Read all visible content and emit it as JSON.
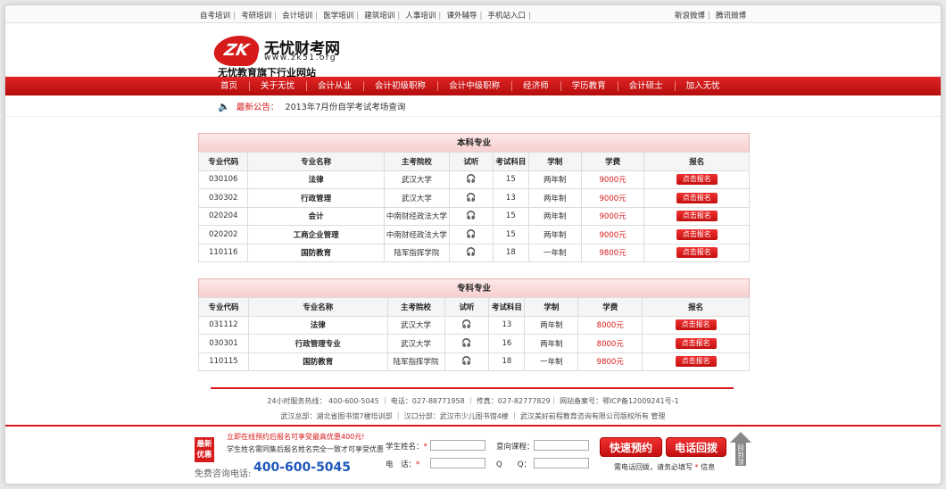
{
  "toplinks": {
    "left": [
      "自考培训",
      "考研培训",
      "会计培训",
      "医学培训",
      "建筑培训",
      "人事培训",
      "课外辅导",
      "手机站入口"
    ],
    "right": [
      "新浪微博",
      "腾讯微博"
    ]
  },
  "logo": {
    "mark": "ZK",
    "name": "无忧财考网",
    "url": "www.zk51.org",
    "tagline": "无忧教育旗下行业网站"
  },
  "nav": [
    "首页",
    "关于无忧",
    "会计从业",
    "会计初级职称",
    "会计中级职称",
    "经济师",
    "学历教育",
    "会计硕士",
    "加入无忧"
  ],
  "notice": {
    "label": "最新公告：",
    "text": "2013年7月份自学考试考场查询"
  },
  "columns": [
    "专业代码",
    "专业名称",
    "主考院校",
    "试听",
    "考试科目",
    "学制",
    "学费",
    "报名"
  ],
  "tables": [
    {
      "title": "本科专业",
      "rows": [
        {
          "code": "030106",
          "name": "法律",
          "school": "武汉大学",
          "subjects": "15",
          "duration": "两年制",
          "fee": "9000元",
          "action": "点击报名"
        },
        {
          "code": "030302",
          "name": "行政管理",
          "school": "武汉大学",
          "subjects": "13",
          "duration": "两年制",
          "fee": "9000元",
          "action": "点击报名"
        },
        {
          "code": "020204",
          "name": "会计",
          "school": "中南财经政法大学",
          "subjects": "15",
          "duration": "两年制",
          "fee": "9000元",
          "action": "点击报名"
        },
        {
          "code": "020202",
          "name": "工商企业管理",
          "school": "中南财经政法大学",
          "subjects": "15",
          "duration": "两年制",
          "fee": "9000元",
          "action": "点击报名"
        },
        {
          "code": "110116",
          "name": "国防教育",
          "school": "陆军指挥学院",
          "subjects": "18",
          "duration": "一年制",
          "fee": "9800元",
          "action": "点击报名"
        }
      ]
    },
    {
      "title": "专科专业",
      "rows": [
        {
          "code": "031112",
          "name": "法律",
          "school": "武汉大学",
          "subjects": "13",
          "duration": "两年制",
          "fee": "8000元",
          "action": "点击报名"
        },
        {
          "code": "030301",
          "name": "行政管理专业",
          "school": "武汉大学",
          "subjects": "16",
          "duration": "两年制",
          "fee": "8000元",
          "action": "点击报名"
        },
        {
          "code": "110115",
          "name": "国防教育",
          "school": "陆军指挥学院",
          "subjects": "18",
          "duration": "一年制",
          "fee": "9800元",
          "action": "点击报名"
        }
      ]
    }
  ],
  "footer": {
    "line1": "24小时服务热线： 400-600-5045 ｜ 电话：027-88771958 ｜ 传真：027-82777829｜ 网站备案号：鄂ICP备12009241号-1",
    "line2": "武汉总部：湖北省图书馆7楼培训部 ｜ 汉口分部：武汉市少儿图书馆4楼 ｜ 武汉美好前程教育咨询有限公司版权所有 管理"
  },
  "bottombar": {
    "badge": "最新优惠",
    "promo1": "立即在线预约后报名可享受最高优惠400元!",
    "promo2": "学生姓名需同集后报名姓名完全一致才可享受优惠",
    "hotline_label": "免费咨询电话:",
    "hotline_number": "400-600-5045",
    "form": {
      "name_label": "学生姓名：",
      "course_label": "意向课程：",
      "phone_label": "电　话：",
      "qq_label": "Q　　Q：",
      "required_mark": "*"
    },
    "buttons": {
      "book": "快速预约",
      "callback": "电话回拨"
    },
    "tip_mark": "*",
    "tip": "需电话回拨，请务必填写",
    "tip_suffix": "信息",
    "back_top": "回到顶部"
  }
}
